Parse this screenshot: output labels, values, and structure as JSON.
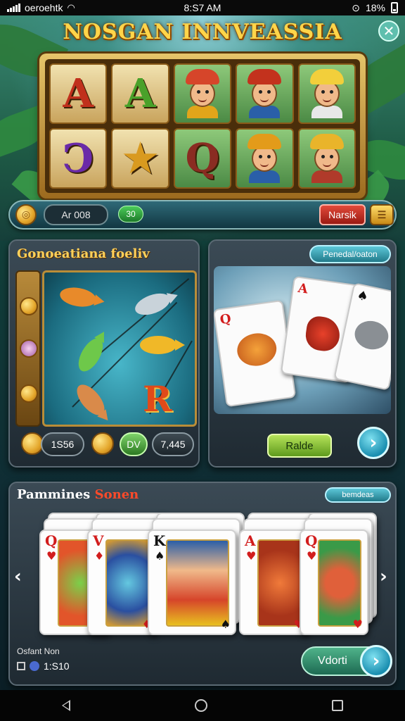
{
  "status_bar": {
    "carrier": "oeroehtk",
    "time": "8:S7 AM",
    "battery": "18%"
  },
  "game": {
    "title": "NOSGAN INNVEASSIA"
  },
  "reel": {
    "symbols": [
      {
        "kind": "letter",
        "text": "A",
        "color": "#c0301c"
      },
      {
        "kind": "letter",
        "text": "A",
        "color": "#49a12a"
      },
      {
        "kind": "face",
        "hat": "#d6452a",
        "shirt": "#e2a51a"
      },
      {
        "kind": "face",
        "hat": "#c3321d",
        "shirt": "#2a5fa8"
      },
      {
        "kind": "face",
        "hat": "#f2cf3b",
        "shirt": "#e8e8e8"
      },
      {
        "kind": "letter",
        "text": "Ͻ",
        "color": "#6a2aa8"
      },
      {
        "kind": "letter",
        "text": "★",
        "color": "#d99a1f"
      },
      {
        "kind": "letter",
        "text": "Q",
        "color": "#8a2c22"
      },
      {
        "kind": "face",
        "hat": "#e39b1a",
        "shirt": "#2a5fa8"
      },
      {
        "kind": "face",
        "hat": "#e9b42a",
        "shirt": "#b03a2a"
      }
    ]
  },
  "controls": {
    "bet_label": "Ar 008",
    "counter": "30",
    "action_label": "Narsik"
  },
  "fishing_panel": {
    "title": "Gonoeatiana foeliv",
    "stats": {
      "value_a": "1S56",
      "value_b": "DV",
      "value_c": "7,445"
    }
  },
  "cards_panel": {
    "tag": "Penedal/oaton",
    "button": "Ralde"
  },
  "bottom_panel": {
    "title_part1": "Pammines",
    "title_part2": "Sonen",
    "tag": "bemdeas",
    "footer_label": "Osfant Non",
    "footer_value": "1:S10",
    "next_button": "Vdorti"
  },
  "card_row": [
    {
      "rank": "Q",
      "suit": "♥",
      "suit_color": "#d21d1d",
      "art": "fish-red"
    },
    {
      "rank": "V",
      "suit": "♦",
      "suit_color": "#d21d1d",
      "art": "fish-blue"
    },
    {
      "rank": "K",
      "suit": "♠",
      "suit_color": "#111111",
      "art": "man-hat"
    },
    {
      "rank": "A",
      "suit": "♥",
      "suit_color": "#d21d1d",
      "art": "fox-red"
    },
    {
      "rank": "Q",
      "suit": "♥",
      "suit_color": "#d21d1d",
      "art": "fox-green"
    }
  ],
  "icons": [
    "signal-icon",
    "wifi-icon",
    "alarm-icon",
    "battery-icon",
    "close-icon",
    "coin-icon",
    "sunflower-icon",
    "chevron-right-icon",
    "chevron-left-icon",
    "android-back-icon",
    "android-home-icon",
    "android-recent-icon"
  ]
}
